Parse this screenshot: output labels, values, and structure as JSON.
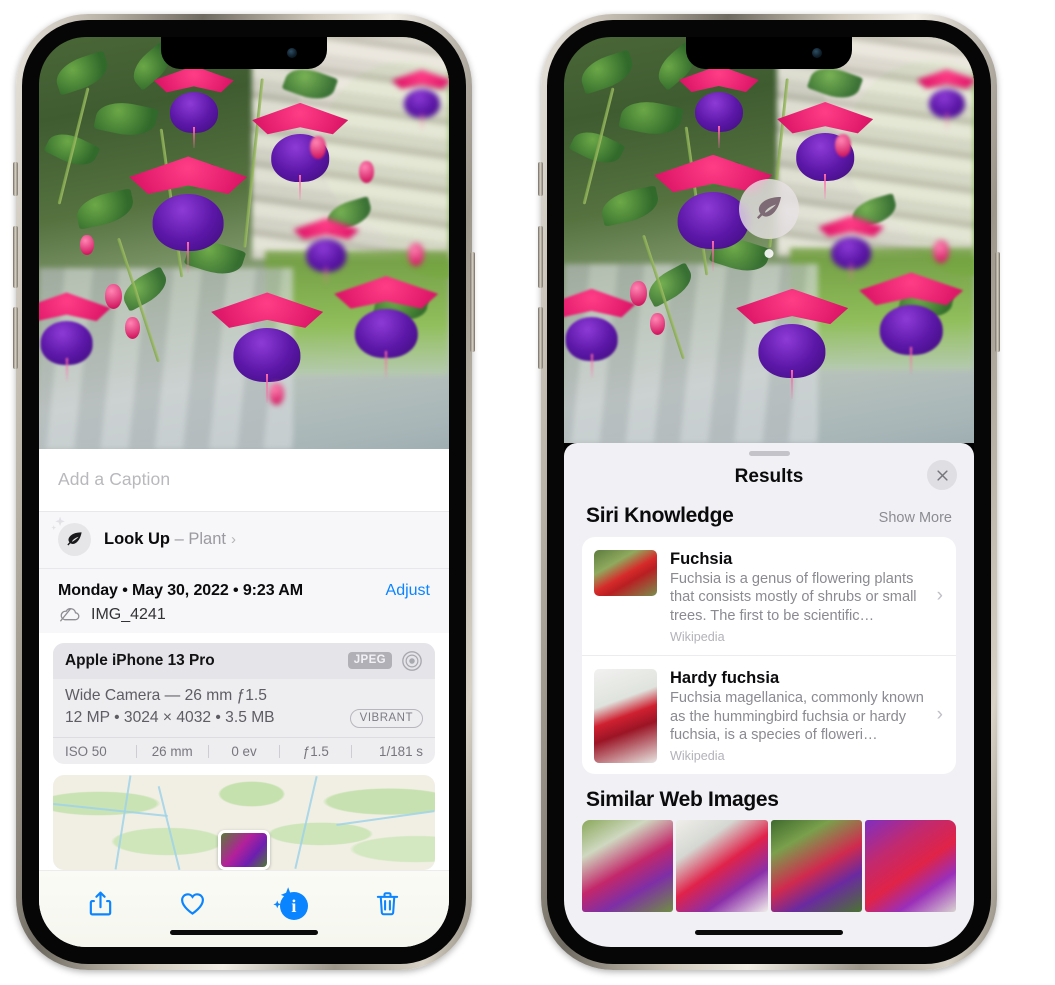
{
  "left_phone": {
    "caption_placeholder": "Add a Caption",
    "lookup": {
      "label": "Look Up",
      "separator": "–",
      "subject": "Plant",
      "chevron": "›",
      "icon": "leaf-icon",
      "sparkle_icon": "sparkle-icon"
    },
    "metadata": {
      "date_line": "Monday • May 30, 2022 • 9:23 AM",
      "adjust_label": "Adjust",
      "filename": "IMG_4241",
      "cloud_icon": "cloud-slash-icon"
    },
    "camera_card": {
      "device": "Apple iPhone 13 Pro",
      "format_badge": "JPEG",
      "aperture_icon": "aperture-icon",
      "lens_line": "Wide Camera — 26 mm ƒ1.5",
      "specs_line": "12 MP • 3024 × 4032 • 3.5 MB",
      "style_badge": "VIBRANT",
      "exif": [
        "ISO 50",
        "26 mm",
        "0 ev",
        "ƒ1.5",
        "1/181 s"
      ]
    },
    "map": {
      "pin_label": "photo-location-pin"
    },
    "toolbar": [
      {
        "name": "share-button",
        "icon": "share-icon"
      },
      {
        "name": "favorite-button",
        "icon": "heart-icon"
      },
      {
        "name": "info-button",
        "icon": "info-sparkle-icon",
        "glyph": "i"
      },
      {
        "name": "delete-button",
        "icon": "trash-icon"
      }
    ],
    "accent_color": "#0b84ff"
  },
  "right_phone": {
    "lens_badge": {
      "icon": "leaf-icon"
    },
    "sheet": {
      "title": "Results",
      "close_icon": "close-icon",
      "sections": [
        {
          "title": "Siri Knowledge",
          "action": "Show More",
          "cards": [
            {
              "title": "Fuchsia",
              "description": "Fuchsia is a genus of flowering plants that consists mostly of shrubs or small trees. The first to be scientific…",
              "source": "Wikipedia",
              "thumb": "fuchsia-red-flowers-thumbnail"
            },
            {
              "title": "Hardy fuchsia",
              "description": "Fuchsia magellanica, commonly known as the hummingbird fuchsia or hardy fuchsia, is a species of floweri…",
              "source": "Wikipedia",
              "thumb": "hardy-fuchsia-branch-thumbnail"
            }
          ]
        },
        {
          "title": "Similar Web Images",
          "tiles": [
            "fuchsia-pink-purple-bloom",
            "fuchsia-red-closeup",
            "fuchsia-shrub-buds",
            "fuchsia-purple-red-cluster"
          ]
        }
      ]
    }
  }
}
